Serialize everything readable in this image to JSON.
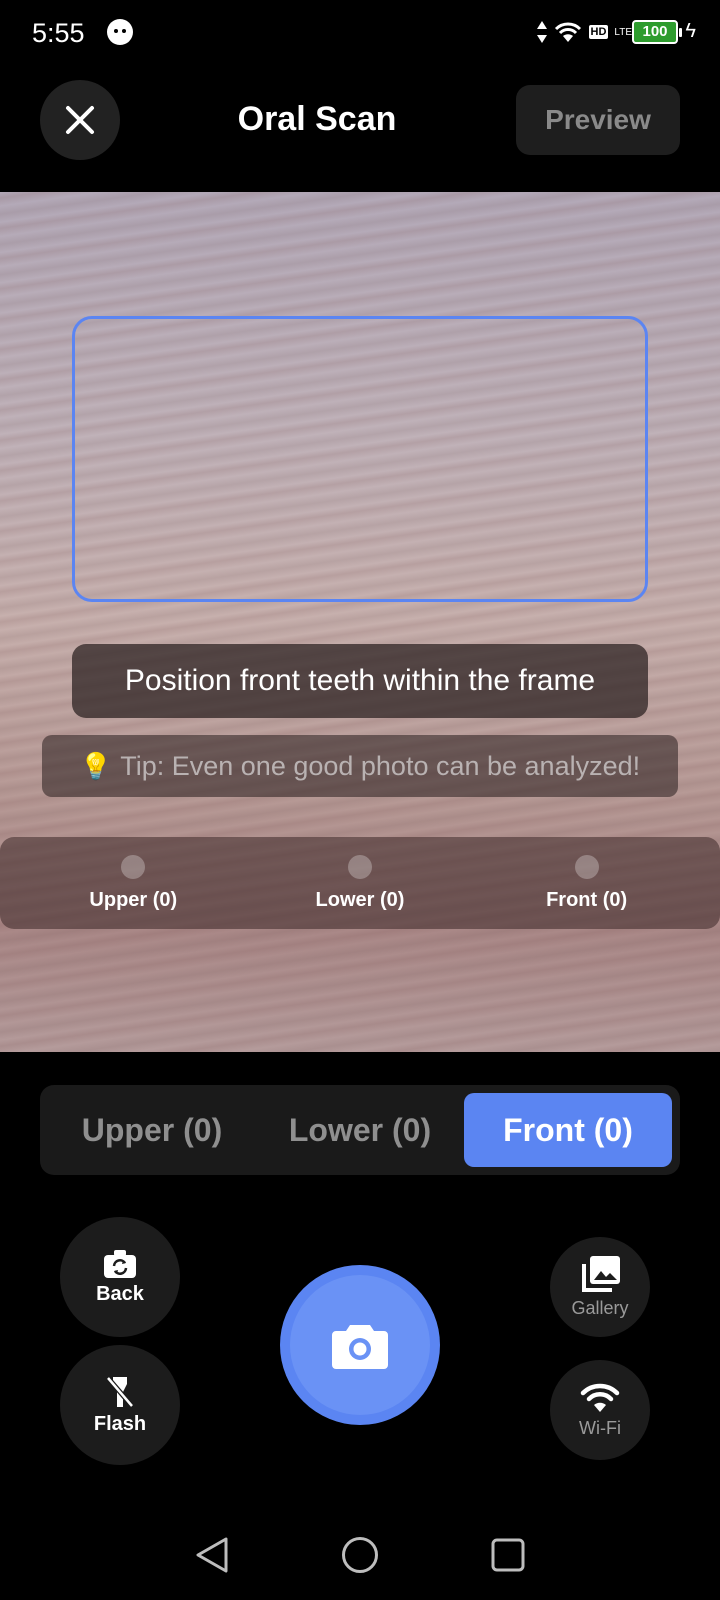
{
  "status_bar": {
    "time": "5:55",
    "hd": "HD",
    "network": "LTE",
    "battery": "100"
  },
  "header": {
    "title": "Oral Scan",
    "preview_label": "Preview",
    "close_icon": "close-icon"
  },
  "camera": {
    "instruction": "Position front teeth within the frame",
    "tip_icon": "💡",
    "tip": "Tip: Even one good photo can be analyzed!",
    "frame_color": "#5b85f2",
    "progress": [
      {
        "label": "Upper (0)"
      },
      {
        "label": "Lower (0)"
      },
      {
        "label": "Front (0)"
      }
    ]
  },
  "tabs": [
    {
      "label": "Upper (0)",
      "active": false
    },
    {
      "label": "Lower (0)",
      "active": false
    },
    {
      "label": "Front (0)",
      "active": true
    }
  ],
  "controls": {
    "back_label": "Back",
    "flash_label": "Flash",
    "gallery_label": "Gallery",
    "wifi_label": "Wi-Fi",
    "accent": "#5b85f2"
  }
}
